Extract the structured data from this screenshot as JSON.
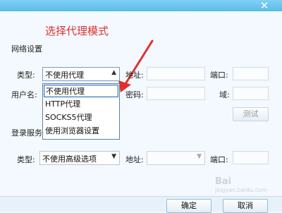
{
  "window": {
    "close_glyph": "✕"
  },
  "annotation": {
    "text": "选择代理模式",
    "color": "#e03030"
  },
  "network": {
    "section_title": "网络设置",
    "type_label": "类型:",
    "type_value": "不使用代理",
    "address_label": "地址:",
    "port_label": "端口:",
    "username_label": "用户名:",
    "password_label": "密码:",
    "domain_label": "域:",
    "test_button": "测试"
  },
  "dropdown": {
    "options": [
      "不使用代理",
      "HTTP代理",
      "SOCKS5代理",
      "使用浏览器设置"
    ],
    "selected_index": 0
  },
  "login": {
    "section_title": "登录服务",
    "type_label": "类型:",
    "type_value": "不使用高级选项",
    "address_label": "地址:",
    "port_label": "端口:"
  },
  "footer": {
    "ok_label": "确定",
    "cancel_label": "取消"
  },
  "watermark": {
    "line1": "Bai",
    "line2": "jingyan.baidu.com"
  },
  "colors": {
    "titlebar": "#5bbbe9",
    "arrow": "#e03030",
    "dropdown_selection": "#3a75c4"
  }
}
